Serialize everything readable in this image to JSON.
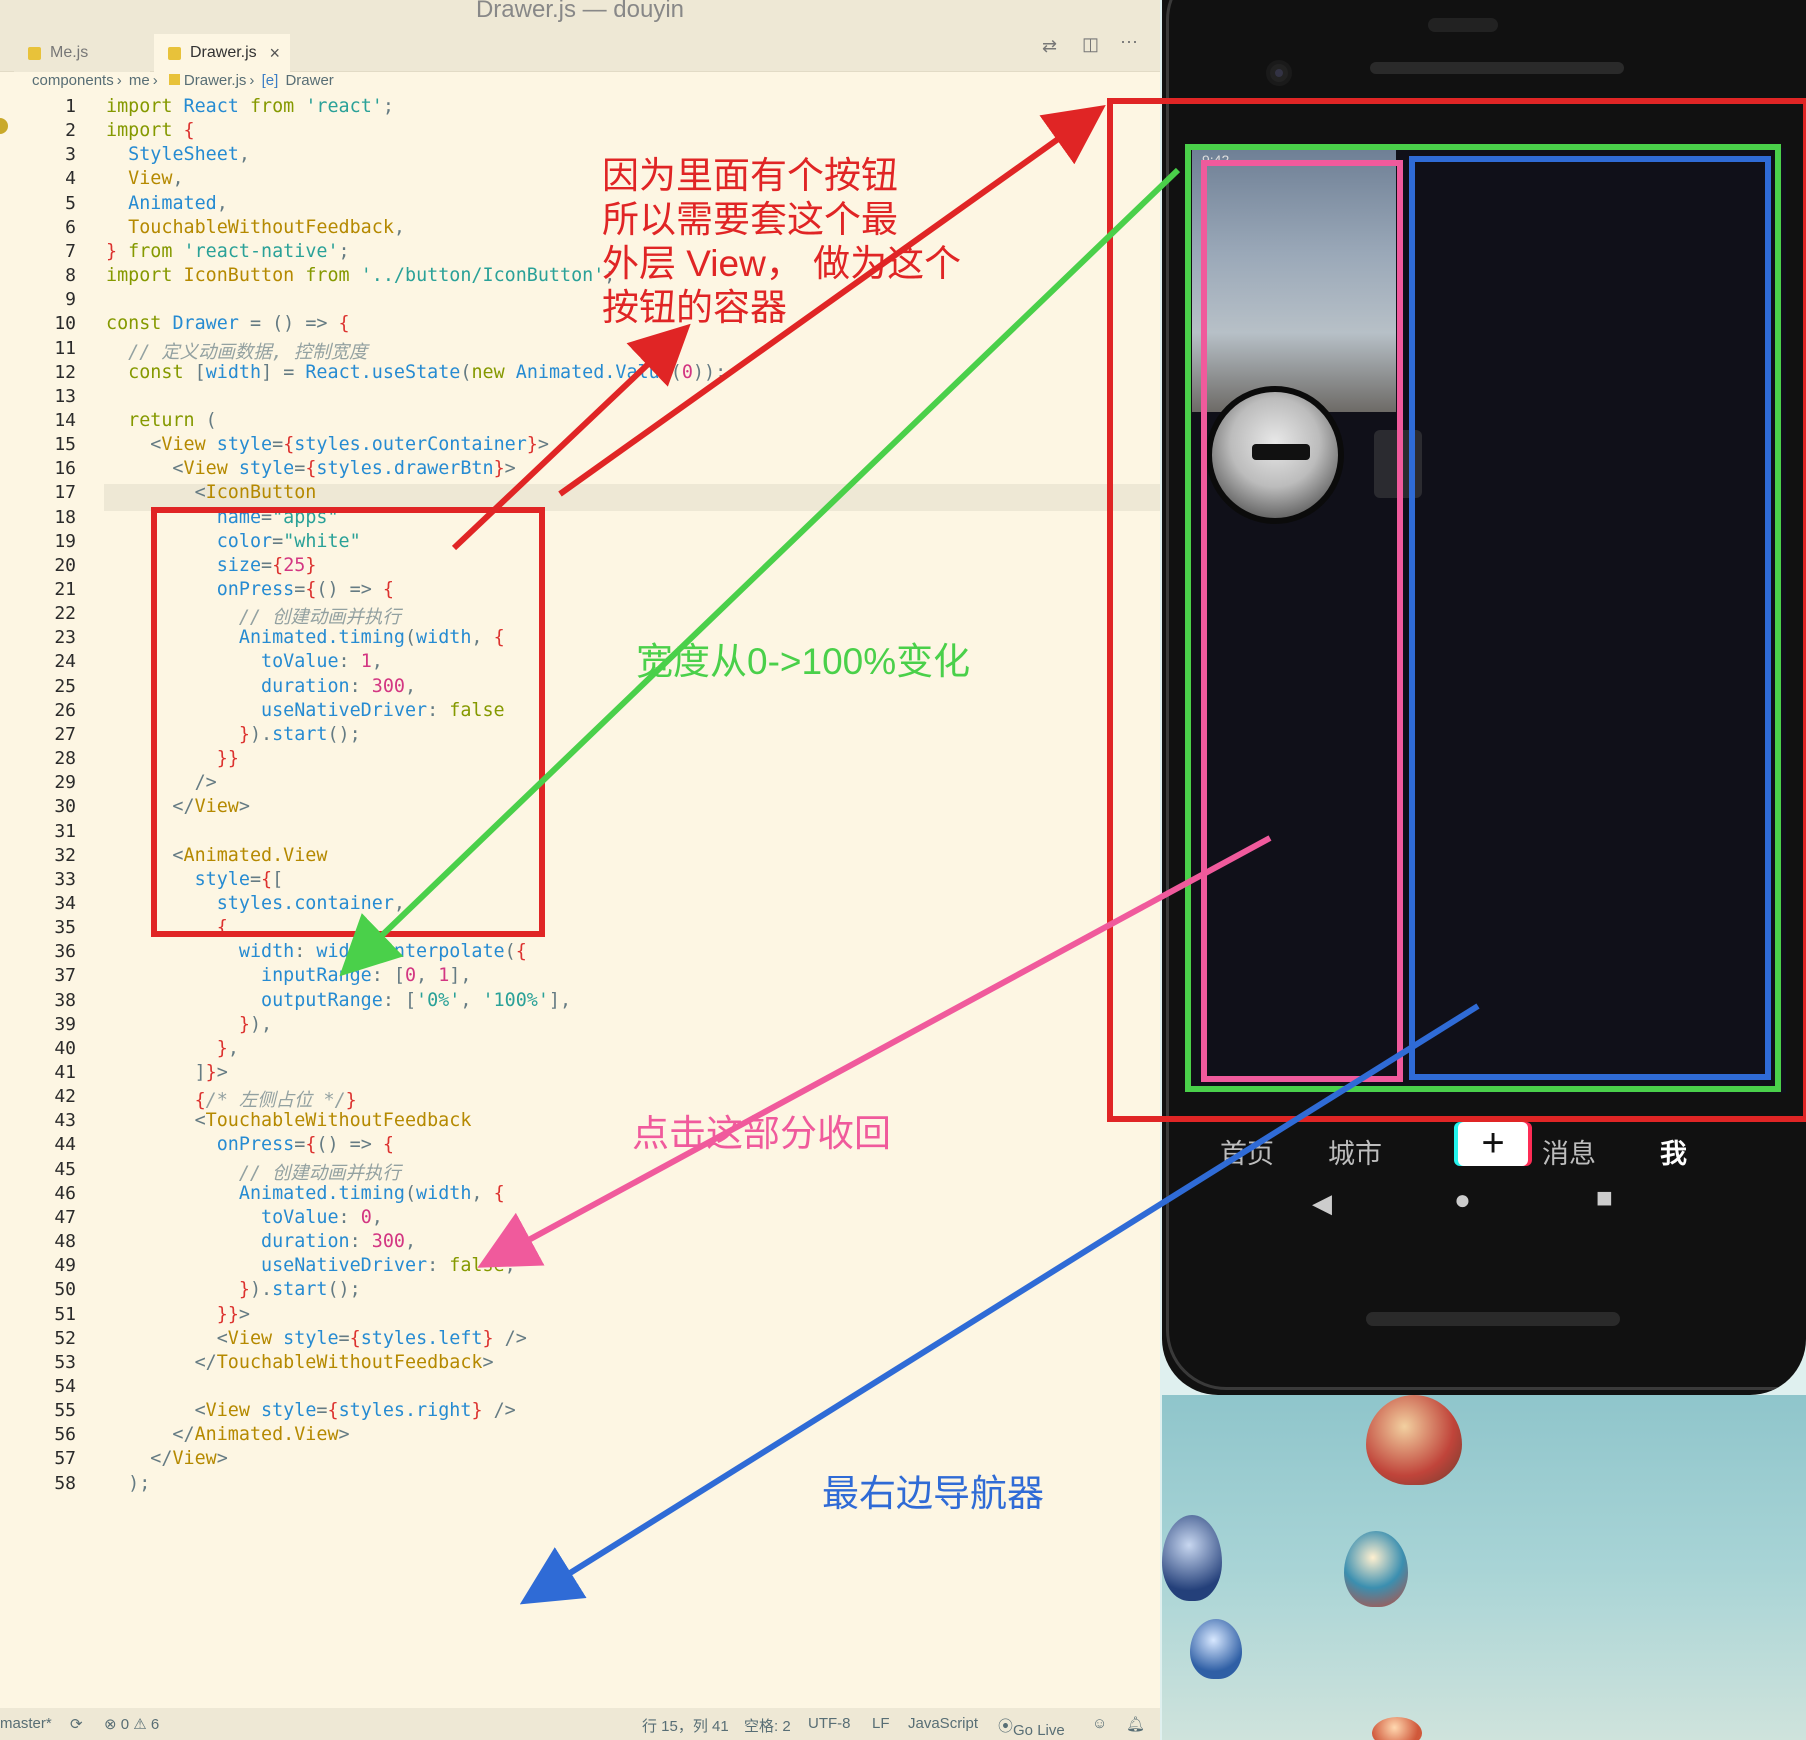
{
  "window": {
    "title": "Drawer.js — douyin"
  },
  "tabs": [
    {
      "label": "Me.js"
    },
    {
      "label": "Drawer.js"
    }
  ],
  "breadcrumb": [
    "components",
    "me",
    "Drawer.js",
    "Drawer"
  ],
  "code_lines": [
    "import React from 'react';",
    "import {",
    "  StyleSheet,",
    "  View,",
    "  Animated,",
    "  TouchableWithoutFeedback,",
    "} from 'react-native';",
    "import IconButton from '../button/IconButton';",
    "",
    "const Drawer = () => {",
    "  // 定义动画数据, 控制宽度",
    "  const [width] = React.useState(new Animated.Value(0));",
    "",
    "  return (",
    "    <View style={styles.outerContainer}>",
    "      <View style={styles.drawerBtn}>",
    "        <IconButton",
    "          name=\"apps\"",
    "          color=\"white\"",
    "          size={25}",
    "          onPress={() => {",
    "            // 创建动画并执行",
    "            Animated.timing(width, {",
    "              toValue: 1,",
    "              duration: 300,",
    "              useNativeDriver: false",
    "            }).start();",
    "          }}",
    "        />",
    "      </View>",
    "",
    "      <Animated.View",
    "        style={[",
    "          styles.container,",
    "          {",
    "            width: width.interpolate({",
    "              inputRange: [0, 1],",
    "              outputRange: ['0%', '100%'],",
    "            }),",
    "          },",
    "        ]}>",
    "        {/* 左侧占位 */}",
    "        <TouchableWithoutFeedback",
    "          onPress={() => {",
    "            // 创建动画并执行",
    "            Animated.timing(width, {",
    "              toValue: 0,",
    "              duration: 300,",
    "              useNativeDriver: false,",
    "            }).start();",
    "          }}>",
    "          <View style={styles.left} />",
    "        </TouchableWithoutFeedback>",
    "",
    "        <View style={styles.right} />",
    "      </Animated.View>",
    "    </View>",
    "  );"
  ],
  "status": {
    "branch": "master*",
    "problems": "⊗ 0 ⚠ 6",
    "position": "行 15，列 41",
    "indent": "空格: 2",
    "encoding": "UTF-8",
    "eol": "LF",
    "language": "JavaScript",
    "golive": "Go Live"
  },
  "phone": {
    "nav_tabs": [
      "首页",
      "城市",
      "+",
      "消息",
      "我"
    ],
    "status_time": "9:42"
  },
  "annotations": {
    "red": [
      "因为里面有个按钮",
      "所以需要套这个最",
      "外层 View，  做为这个",
      "按钮的容器"
    ],
    "green": "宽度从0->100%变化",
    "pink": "点击这部分收回",
    "blue": "最右边导航器"
  },
  "colors": {
    "red": "#e02525",
    "green": "#4ad04a",
    "pink": "#f05a9c",
    "blue": "#2f6bd6",
    "editor_bg": "#fdf6e3"
  }
}
